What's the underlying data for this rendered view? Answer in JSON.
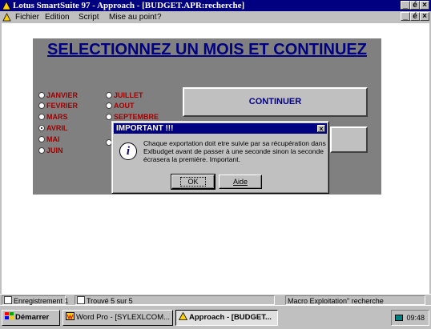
{
  "window": {
    "title": "Lotus SmartSuite 97 - Approach - [BUDGET.APR:recherche]",
    "controls": [
      "_",
      "é",
      "×"
    ]
  },
  "menu": {
    "items": [
      "Fichier",
      "Edition",
      "Script",
      "Mise au point",
      "?"
    ]
  },
  "form": {
    "heading": "SELECTIONNEZ UN MOIS ET CONTINUEZ",
    "months_left": [
      "JANVIER",
      "FEVRIER",
      "MARS",
      "AVRIL",
      "MAI",
      "JUIN"
    ],
    "months_right": [
      "JUILLET",
      "AOUT",
      "SEPTEMBRE"
    ],
    "selected_month": "AVRIL",
    "continue_label": "CONTINUER"
  },
  "dialog": {
    "title": "IMPORTANT !!!",
    "close": "×",
    "icon": "info-icon",
    "message": "Chaque exportation doit etre suivie par sa récupération dans Exlbudget avant de passer à une seconde sinon la seconde écrasera la première. Important.",
    "ok_label": "OK",
    "help_label": "Aide"
  },
  "statusbar": {
    "record_label": "Enregistrement 1",
    "found_label": "Trouvé 5 sur 5",
    "macro_label": "Macro Exploitation\" recherche"
  },
  "taskbar": {
    "start_label": "Démarrer",
    "tasks": [
      "Word Pro - [SYLEXLCOM...",
      "Approach - [BUDGET..."
    ],
    "clock": "09:48"
  },
  "colors": {
    "titlebar": "#000080",
    "panel": "#808080",
    "heading": "#000080",
    "month_text": "#a00000"
  }
}
